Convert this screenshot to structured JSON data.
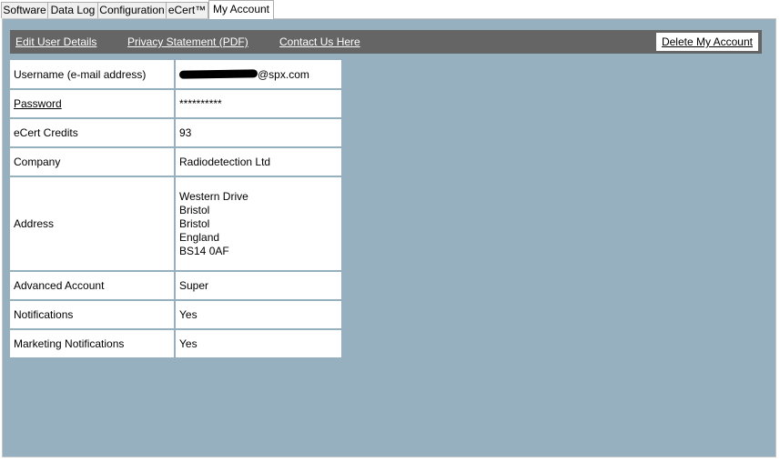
{
  "tabs": [
    {
      "label": "Software"
    },
    {
      "label": "Data Log"
    },
    {
      "label": "Configuration"
    },
    {
      "label": "eCert™"
    },
    {
      "label": "My Account"
    }
  ],
  "toolbar": {
    "edit_user_details": "Edit User Details",
    "privacy_statement": "Privacy Statement (PDF)",
    "contact_us": "Contact Us Here",
    "delete_account": "Delete My Account"
  },
  "account": {
    "username_label": "Username (e-mail address)",
    "username_visible": "@spx.com",
    "password_label": "Password",
    "password_value": "**********",
    "credits_label": "eCert Credits",
    "credits_value": "93",
    "company_label": "Company",
    "company_value": "Radiodetection Ltd",
    "address_label": "Address",
    "address_lines": [
      "Western Drive",
      "Bristol",
      "Bristol",
      "England",
      "BS14 0AF"
    ],
    "advanced_label": "Advanced Account",
    "advanced_value": "Super",
    "notifications_label": "Notifications",
    "notifications_value": "Yes",
    "marketing_label": "Marketing Notifications",
    "marketing_value": "Yes"
  }
}
